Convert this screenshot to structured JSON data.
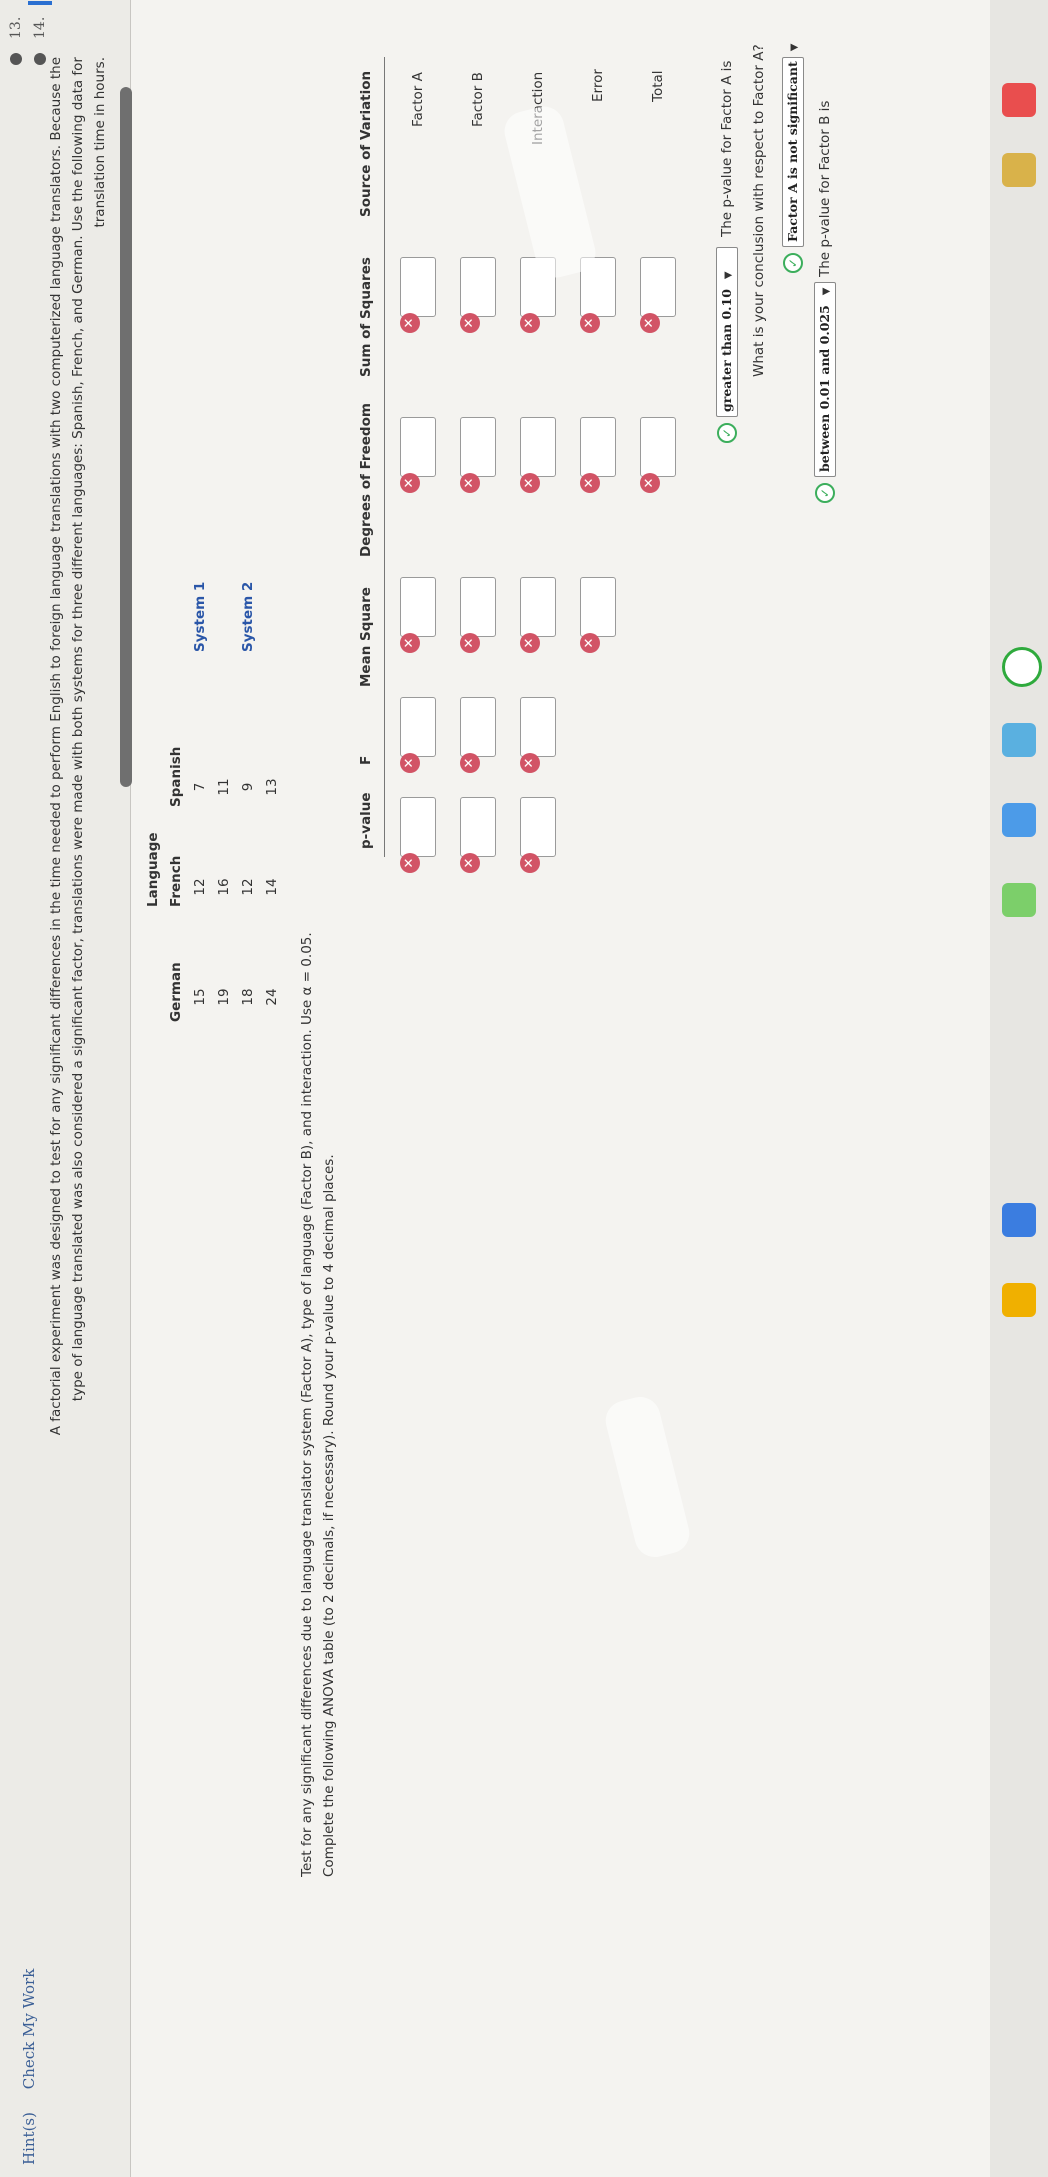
{
  "top": {
    "hint": "Hint(s)",
    "check": "Check My Work"
  },
  "questions": [
    {
      "num": "13."
    },
    {
      "num": "14."
    }
  ],
  "problem": {
    "line1": "A factorial experiment was designed to test for any significant differences in the time needed to perform English to foreign language translations with two computerized language translators. Because the",
    "line2": "type of language translated was also considered a significant factor, translations were made with both systems for three different languages: Spanish, French, and German. Use the following data for",
    "line3": "translation time in hours."
  },
  "data_table": {
    "group_header": "Language",
    "columns": [
      "Spanish",
      "French",
      "German"
    ],
    "rows": [
      {
        "system": "System 1",
        "values": [
          [
            "7",
            "11"
          ],
          [
            "12",
            "16"
          ],
          [
            "15",
            "19"
          ]
        ]
      },
      {
        "system": "System 2",
        "values": [
          [
            "9",
            "13"
          ],
          [
            "12",
            "14"
          ],
          [
            "18",
            "24"
          ]
        ]
      }
    ]
  },
  "instructions": {
    "line1": "Test for any significant differences due to language translator system (Factor A), type of language (Factor B), and interaction. Use α = 0.05.",
    "line2": "Complete the following ANOVA table (to 2 decimals, if necessary). Round your p-value to 4 decimal places."
  },
  "anova": {
    "headers": [
      "Source of Variation",
      "Sum of Squares",
      "Degrees of Freedom",
      "Mean Square",
      "F",
      "p-value"
    ],
    "rows": [
      "Factor A",
      "Factor B",
      "Interaction",
      "Error",
      "Total"
    ]
  },
  "q_factor_a": {
    "pvalue_text": "The p-value for Factor A is",
    "pvalue_select": "greater than 0.10",
    "conclusion_question": "What is your conclusion with respect to Factor A?",
    "conclusion_select": "Factor A is not significant"
  },
  "q_factor_b": {
    "pvalue_text": "The p-value for Factor B is",
    "pvalue_select": "between 0.01 and 0.025"
  },
  "colors": {
    "error": "#d25466",
    "correct": "#3cae5c",
    "link": "#3b5f96",
    "system": "#2a56a8"
  }
}
